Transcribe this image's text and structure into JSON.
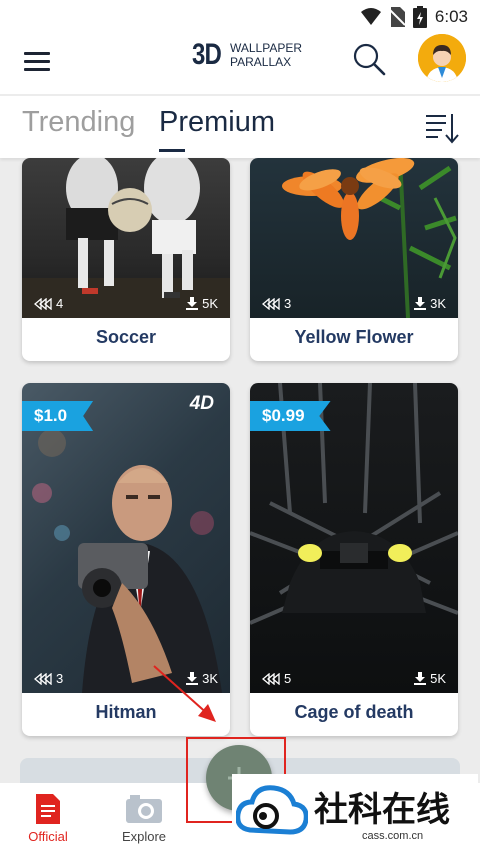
{
  "status_bar": {
    "time": "6:03"
  },
  "app": {
    "logo_big": "3D",
    "logo_line1": "WALLPAPER",
    "logo_line2": "PARALLAX"
  },
  "tabs": [
    {
      "label": "Trending"
    },
    {
      "label": "Premium"
    }
  ],
  "cards": [
    {
      "title": "Soccer",
      "likes": "4",
      "downloads": "5K"
    },
    {
      "title": "Yellow Flower",
      "likes": "3",
      "downloads": "3K"
    },
    {
      "title": "Hitman",
      "likes": "3",
      "downloads": "3K",
      "price": "$1.0",
      "badge": "4D"
    },
    {
      "title": "Cage of death",
      "likes": "5",
      "downloads": "5K",
      "price": "$0.99"
    }
  ],
  "bottom_nav": [
    {
      "label": "Official"
    },
    {
      "label": "Explore"
    }
  ],
  "watermark": {
    "brand": "社科在线",
    "url": "cass.com.cn"
  },
  "colors": {
    "accent": "#1a2a43",
    "price_tag": "#1aa2e0",
    "active_nav": "#e0241f"
  }
}
